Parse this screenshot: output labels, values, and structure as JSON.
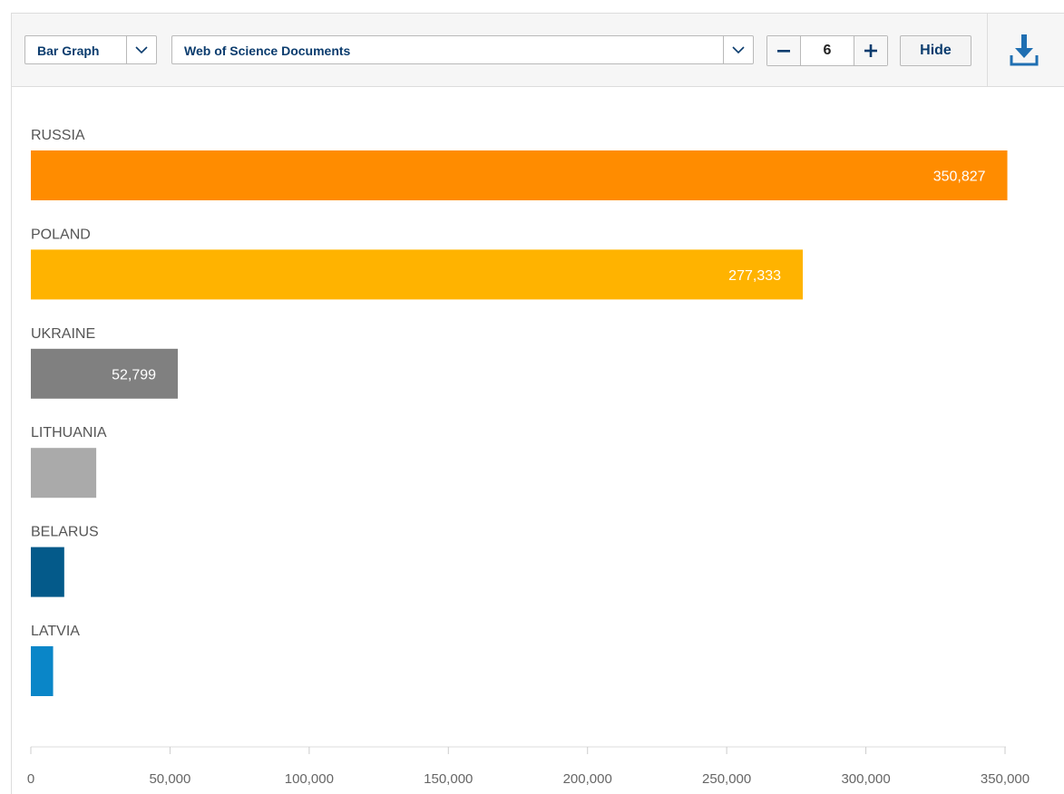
{
  "toolbar": {
    "chart_type_label": "Bar Graph",
    "metric_label": "Web of Science Documents",
    "count_value": "6",
    "hide_label": "Hide"
  },
  "icons": {
    "chart_type_dropdown": "chevron-down-icon",
    "metric_dropdown": "chevron-down-icon",
    "decrement": "minus-icon",
    "increment": "plus-icon",
    "download": "download-icon"
  },
  "chart_data": {
    "type": "bar",
    "orientation": "horizontal",
    "categories": [
      "RUSSIA",
      "POLAND",
      "UKRAINE",
      "LITHUANIA",
      "BELARUS",
      "LATVIA"
    ],
    "values": [
      350827,
      277333,
      52799,
      23500,
      12000,
      8000
    ],
    "data_labels": [
      "350,827",
      "277,333",
      "52,799",
      "",
      "",
      ""
    ],
    "colors": [
      "#ff8c00",
      "#ffb300",
      "#808080",
      "#aaaaaa",
      "#045a8a",
      "#0a86c8"
    ],
    "xlim": [
      0,
      350000
    ],
    "xticks": [
      0,
      50000,
      100000,
      150000,
      200000,
      250000,
      300000,
      350000
    ],
    "xtick_labels": [
      "0",
      "50,000",
      "100,000",
      "150,000",
      "200,000",
      "250,000",
      "300,000",
      "350,000"
    ],
    "grid": false,
    "legend": "none"
  }
}
